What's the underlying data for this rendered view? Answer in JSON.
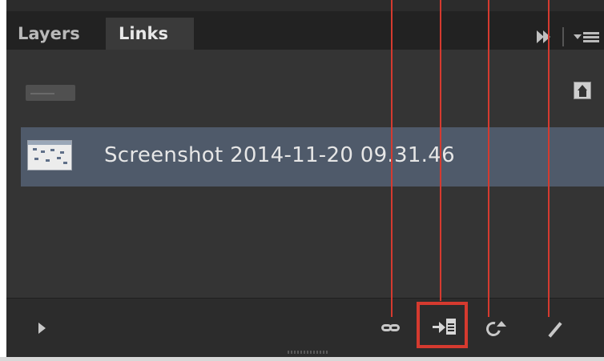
{
  "tabs": [
    {
      "label": "Layers"
    },
    {
      "label": "Links"
    }
  ],
  "links": {
    "selected_file": "Screenshot 2014-11-20 09.31.46"
  },
  "toolbar": {
    "items": [
      {
        "name": "relink-icon"
      },
      {
        "name": "go-to-link-icon"
      },
      {
        "name": "update-link-icon"
      },
      {
        "name": "edit-original-icon"
      }
    ],
    "highlight_color": "#d53a2f"
  },
  "colors": {
    "panel_background": "#343434",
    "selected_row": "#4f5a6a",
    "tab_active": "#3a3a3a",
    "tab_inactive": "#222222"
  }
}
